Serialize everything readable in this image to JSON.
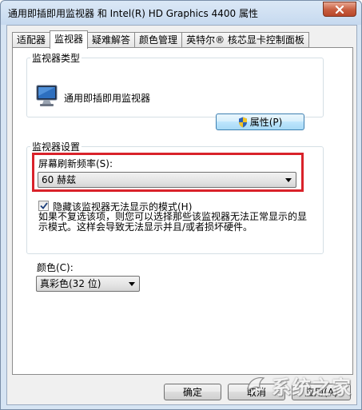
{
  "window": {
    "title": "通用即插即用监视器 和 Intel(R) HD Graphics 4400 属性"
  },
  "tabs": [
    {
      "label": "适配器",
      "active": false
    },
    {
      "label": "监视器",
      "active": true
    },
    {
      "label": "疑难解答",
      "active": false
    },
    {
      "label": "颜色管理",
      "active": false
    },
    {
      "label": "英特尔® 核芯显卡控制面板",
      "active": false
    }
  ],
  "monitor_type": {
    "group_label": "监视器类型",
    "name": "通用即插即用监视器",
    "properties_button": "属性(P)"
  },
  "monitor_settings": {
    "group_label": "监视器设置",
    "refresh_label": "屏幕刷新频率(S):",
    "refresh_value": "60 赫兹",
    "hide_modes_label": "隐藏该监视器无法显示的模式(H)",
    "hide_modes_checked": true,
    "description": "如果不复选该项，则您可以选择那些该监视器无法正常显示的显示模式。这样会导致无法显示并且/或者损坏硬件。"
  },
  "colors": {
    "label": "颜色(C):",
    "value": "真彩色(32 位)"
  },
  "dialog_buttons": {
    "ok": "确定",
    "cancel": "取消",
    "apply": "应用(A)"
  },
  "watermark": {
    "text": "系统之家"
  },
  "highlight_color": "#d9222a"
}
